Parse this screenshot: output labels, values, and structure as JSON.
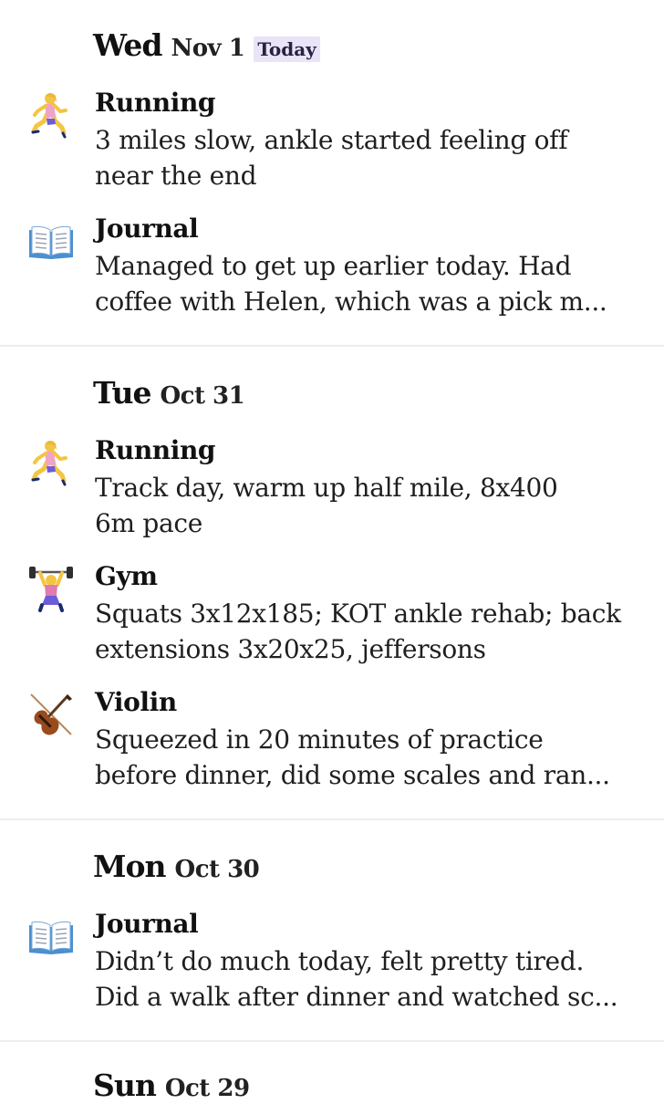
{
  "days": [
    {
      "dow": "Wed",
      "date": "Nov 1",
      "badge": "Today",
      "entries": [
        {
          "icon": "running-icon",
          "title": "Running",
          "lines": [
            "3 miles slow, ankle started feeling off",
            "near the end"
          ]
        },
        {
          "icon": "book-icon",
          "title": "Journal",
          "lines": [
            "Managed to get up earlier today. Had",
            "coffee with Helen, which was a pick m..."
          ]
        }
      ]
    },
    {
      "dow": "Tue",
      "date": "Oct 31",
      "entries": [
        {
          "icon": "running-icon",
          "title": "Running",
          "lines": [
            "Track day, warm up half mile, 8x400",
            "6m pace"
          ]
        },
        {
          "icon": "weightlifting-icon",
          "title": "Gym",
          "lines": [
            "Squats 3x12x185; KOT ankle rehab; back",
            "extensions 3x20x25, jeffersons"
          ]
        },
        {
          "icon": "violin-icon",
          "title": "Violin",
          "lines": [
            "Squeezed in 20 minutes of practice",
            "before dinner, did some scales and ran..."
          ]
        }
      ]
    },
    {
      "dow": "Mon",
      "date": "Oct 30",
      "entries": [
        {
          "icon": "book-icon",
          "title": "Journal",
          "lines": [
            "Didn’t do much today, felt pretty tired.",
            "Did a walk after dinner and watched sc..."
          ]
        }
      ]
    },
    {
      "dow": "Sun",
      "date": "Oct 29",
      "entries": []
    }
  ]
}
